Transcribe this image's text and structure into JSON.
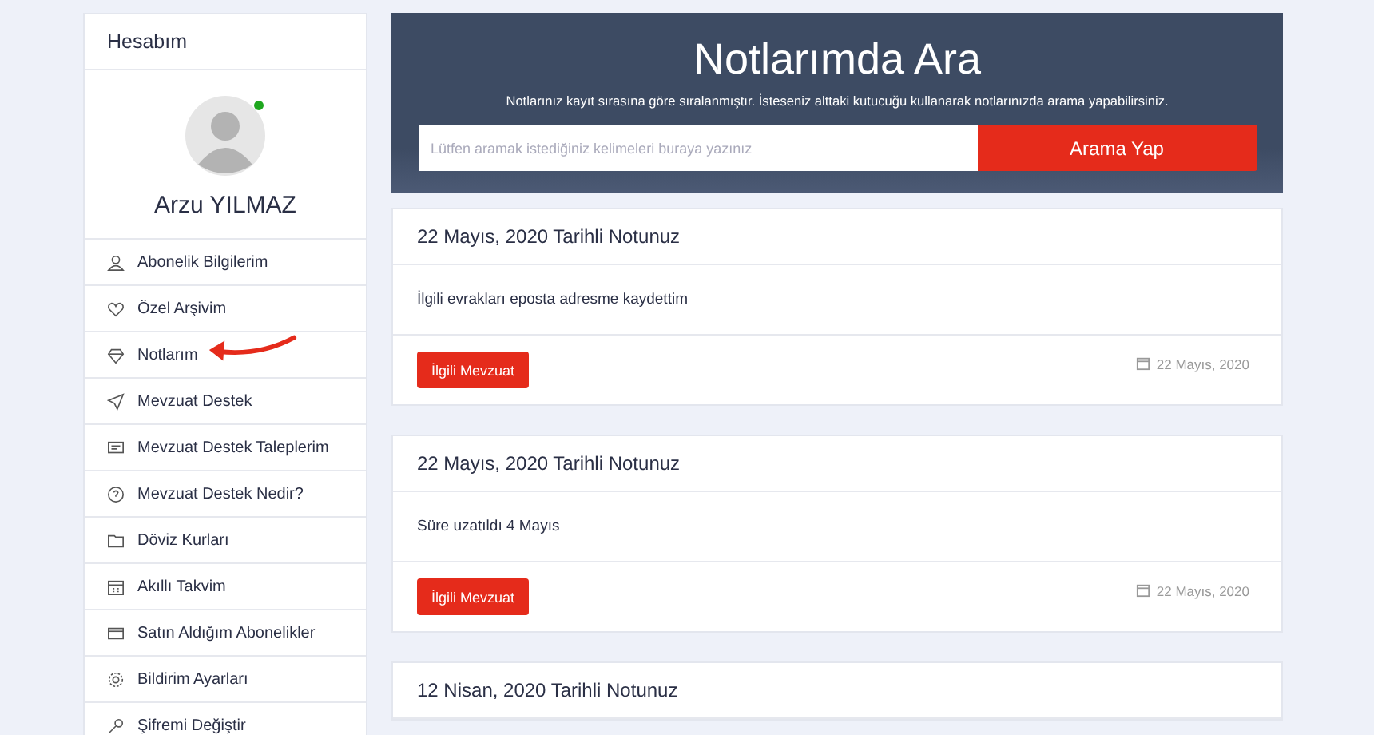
{
  "sidebar": {
    "title": "Hesabım",
    "profile": {
      "name": "Arzu YILMAZ",
      "online": true
    },
    "items": [
      {
        "label": "Abonelik Bilgilerim",
        "highlighted": false
      },
      {
        "label": "Özel Arşivim",
        "highlighted": false
      },
      {
        "label": "Notlarım",
        "highlighted": true
      },
      {
        "label": "Mevzuat Destek",
        "highlighted": false
      },
      {
        "label": "Mevzuat Destek Taleplerim",
        "highlighted": false
      },
      {
        "label": "Mevzuat Destek Nedir?",
        "highlighted": false
      },
      {
        "label": "Döviz Kurları",
        "highlighted": false
      },
      {
        "label": "Akıllı Takvim",
        "highlighted": false
      },
      {
        "label": "Satın Aldığım Abonelikler",
        "highlighted": false
      },
      {
        "label": "Bildirim Ayarları",
        "highlighted": false
      },
      {
        "label": "Şifremi Değiştir",
        "highlighted": false
      }
    ]
  },
  "search": {
    "title": "Notlarımda Ara",
    "subtitle": "Notlarınız kayıt sırasına göre sıralanmıştır. İsteseniz alttaki kutucuğu kullanarak notlarınızda arama yapabilirsiniz.",
    "placeholder": "Lütfen aramak istediğiniz kelimeleri buraya yazınız",
    "button": "Arama Yap"
  },
  "notes": [
    {
      "title": "22 Mayıs, 2020 Tarihli Notunuz",
      "body": "İlgili evrakları eposta adresme kaydettim",
      "button": "İlgili Mevzuat",
      "date": "22 Mayıs, 2020"
    },
    {
      "title": "22 Mayıs, 2020 Tarihli Notunuz",
      "body": "Süre uzatıldı 4 Mayıs",
      "button": "İlgili Mevzuat",
      "date": "22 Mayıs, 2020"
    },
    {
      "title": "12 Nisan, 2020 Tarihli Notunuz"
    }
  ]
}
